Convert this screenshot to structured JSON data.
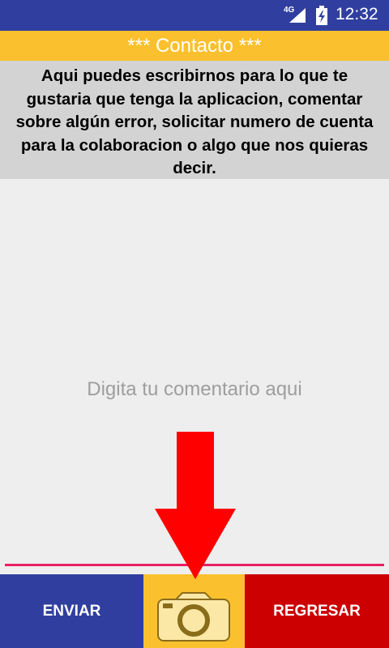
{
  "status_bar": {
    "network": "4G",
    "time": "12:32",
    "icons": [
      "signal-icon",
      "battery-charging-icon"
    ]
  },
  "header": {
    "title": "*** Contacto ***"
  },
  "info_text": "Aqui puedes escribirnos para lo que te gustaria que tenga la aplicacion, comentar sobre algún error, solicitar numero de cuenta para la colaboracion o algo que nos quieras decir.",
  "comment": {
    "value": "",
    "placeholder": "Digita tu comentario aqui"
  },
  "overlay": {
    "icon": "down-arrow-icon",
    "color": "#ff0000"
  },
  "buttons": {
    "send_label": "ENVIAR",
    "camera_icon": "camera-icon",
    "back_label": "REGRESAR"
  },
  "colors": {
    "primary": "#303f9f",
    "accent_yellow": "#fbc02d",
    "accent_red": "#cc0000",
    "input_underline": "#e91e63",
    "info_background": "#d3d3d3",
    "background": "#eeeeee"
  }
}
